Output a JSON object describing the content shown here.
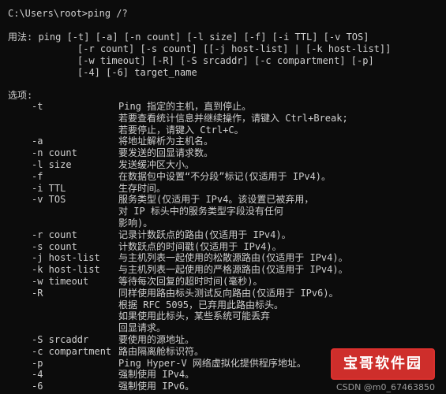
{
  "terminal": {
    "prompt_line": "C:\\Users\\root>ping /?",
    "usage": [
      "用法: ping [-t] [-a] [-n count] [-l size] [-f] [-i TTL] [-v TOS]",
      "[-r count] [-s count] [[-j host-list] | [-k host-list]]",
      "[-w timeout] [-R] [-S srcaddr] [-c compartment] [-p]",
      "[-4] [-6] target_name"
    ],
    "options_header": "选项:",
    "options": [
      {
        "flag": "-t",
        "desc": [
          "Ping 指定的主机，直到停止。",
          "若要查看统计信息并继续操作，请键入 Ctrl+Break;",
          "若要停止，请键入 Ctrl+C。"
        ]
      },
      {
        "flag": "-a",
        "desc": [
          "将地址解析为主机名。"
        ]
      },
      {
        "flag": "-n count",
        "desc": [
          "要发送的回显请求数。"
        ]
      },
      {
        "flag": "-l size",
        "desc": [
          "发送缓冲区大小。"
        ]
      },
      {
        "flag": "-f",
        "desc": [
          "在数据包中设置“不分段”标记(仅适用于 IPv4)。"
        ]
      },
      {
        "flag": "-i TTL",
        "desc": [
          "生存时间。"
        ]
      },
      {
        "flag": "-v TOS",
        "desc": [
          "服务类型(仅适用于 IPv4。该设置已被弃用，",
          "对 IP 标头中的服务类型字段没有任何",
          "影响)。"
        ]
      },
      {
        "flag": "-r count",
        "desc": [
          "记录计数跃点的路由(仅适用于 IPv4)。"
        ]
      },
      {
        "flag": "-s count",
        "desc": [
          "计数跃点的时间戳(仅适用于 IPv4)。"
        ]
      },
      {
        "flag": "-j host-list",
        "desc": [
          "与主机列表一起使用的松散源路由(仅适用于 IPv4)。"
        ]
      },
      {
        "flag": "-k host-list",
        "desc": [
          "与主机列表一起使用的严格源路由(仅适用于 IPv4)。"
        ]
      },
      {
        "flag": "-w timeout",
        "desc": [
          "等待每次回复的超时时间(毫秒)。"
        ]
      },
      {
        "flag": "-R",
        "desc": [
          "同样使用路由标头测试反向路由(仅适用于 IPv6)。",
          "根据 RFC 5095，已弃用此路由标头。",
          "如果使用此标头，某些系统可能丢弃",
          "回显请求。"
        ]
      },
      {
        "flag": "-S srcaddr",
        "desc": [
          "要使用的源地址。"
        ]
      },
      {
        "flag": "-c compartment",
        "desc": [
          "路由隔离舱标识符。"
        ]
      },
      {
        "flag": "-p",
        "desc": [
          "Ping Hyper-V 网络虚拟化提供程序地址。"
        ]
      },
      {
        "flag": "-4",
        "desc": [
          "强制使用 IPv4。"
        ]
      },
      {
        "flag": "-6",
        "desc": [
          "强制使用 IPv6。"
        ]
      }
    ]
  },
  "watermark": {
    "logo_text": "宝哥软件园",
    "sub_text": "CSDN @m0_67463850"
  },
  "colors": {
    "background": "#0c0c0c",
    "text": "#cfcfcf",
    "watermark_red": "#d9302d"
  }
}
